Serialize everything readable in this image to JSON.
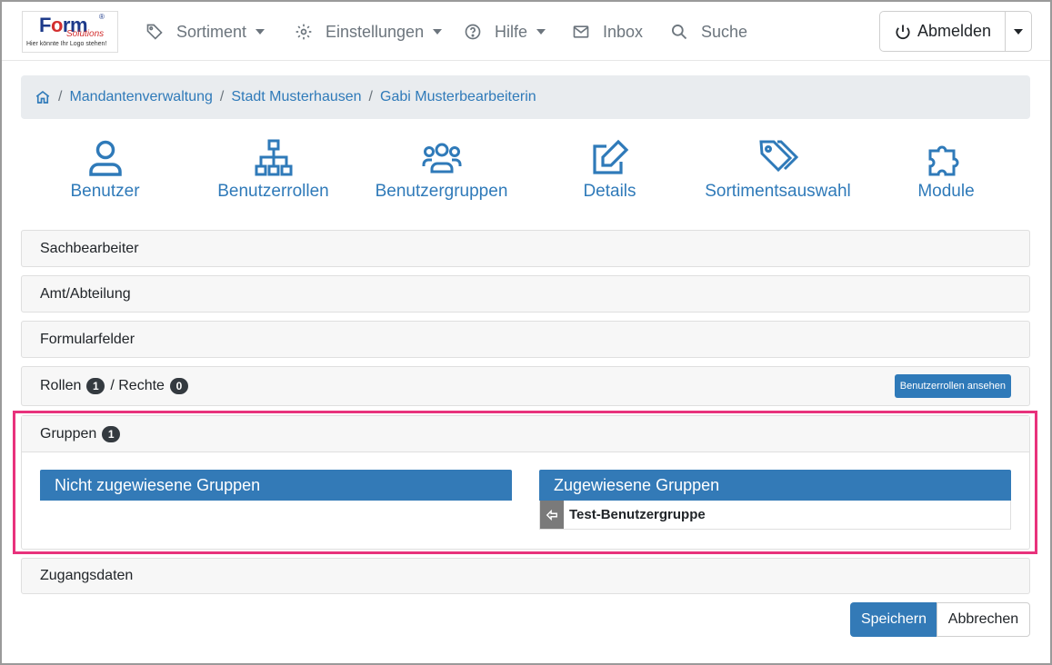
{
  "nav": {
    "logo": {
      "brand_main": "F",
      "brand_o": "o",
      "brand_rm": "rm",
      "brand_sub": "Solutions",
      "tagline": "Hier könnte Ihr Logo stehen!",
      "icon": "form-solutions-logo"
    },
    "items": [
      {
        "label": "Sortiment",
        "icon": "tag-icon",
        "dropdown": true
      },
      {
        "label": "Einstellungen",
        "icon": "gear-icon",
        "dropdown": true
      },
      {
        "label": "Hilfe",
        "icon": "help-circle-icon",
        "dropdown": true
      },
      {
        "label": "Inbox",
        "icon": "envelope-icon",
        "dropdown": false
      },
      {
        "label": "Suche",
        "icon": "search-icon",
        "dropdown": false
      }
    ],
    "logout_label": "Abmelden"
  },
  "breadcrumb": {
    "items": [
      "Mandantenverwaltung",
      "Stadt Musterhausen",
      "Gabi Musterbearbeiterin"
    ]
  },
  "tiles": [
    {
      "label": "Benutzer",
      "icon": "user-icon"
    },
    {
      "label": "Benutzerrollen",
      "icon": "sitemap-icon"
    },
    {
      "label": "Benutzergruppen",
      "icon": "users-icon"
    },
    {
      "label": "Details",
      "icon": "edit-icon"
    },
    {
      "label": "Sortimentsauswahl",
      "icon": "tags-icon"
    },
    {
      "label": "Module",
      "icon": "puzzle-icon"
    }
  ],
  "sections": {
    "sachbearbeiter": "Sachbearbeiter",
    "amt": "Amt/Abteilung",
    "formularfelder": "Formularfelder",
    "rollen_label": "Rollen",
    "rollen_count": "1",
    "rechte_label": "/ Rechte",
    "rechte_count": "0",
    "rollen_button": "Benutzerrollen ansehen",
    "gruppen_label": "Gruppen",
    "gruppen_count": "1",
    "zugangsdaten": "Zugangsdaten"
  },
  "groups": {
    "unassigned_title": "Nicht zugewiesene Gruppen",
    "assigned_title": "Zugewiesene Gruppen",
    "assigned": [
      "Test-Benutzergruppe"
    ]
  },
  "footer": {
    "save": "Speichern",
    "cancel": "Abbrechen"
  },
  "colors": {
    "primary": "#337ab7",
    "link": "#2f7ab9",
    "highlight": "#e8327c",
    "badge": "#343a40"
  }
}
